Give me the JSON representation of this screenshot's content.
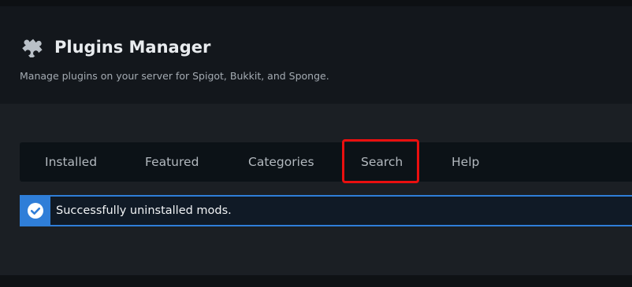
{
  "header": {
    "icon": "puzzle-piece-icon",
    "title": "Plugins Manager",
    "subtitle": "Manage plugins on your server for Spigot, Bukkit, and Sponge."
  },
  "tabs": [
    {
      "label": "Installed"
    },
    {
      "label": "Featured"
    },
    {
      "label": "Categories"
    },
    {
      "label": "Search",
      "highlighted": true
    },
    {
      "label": "Help"
    }
  ],
  "alert": {
    "icon": "check-circle-icon",
    "message": "Successfully uninstalled mods.",
    "color": "#2f7ed8"
  },
  "colors": {
    "highlight": "#ea0f0f",
    "background": "#1b1f24",
    "header_background": "#13171c"
  }
}
